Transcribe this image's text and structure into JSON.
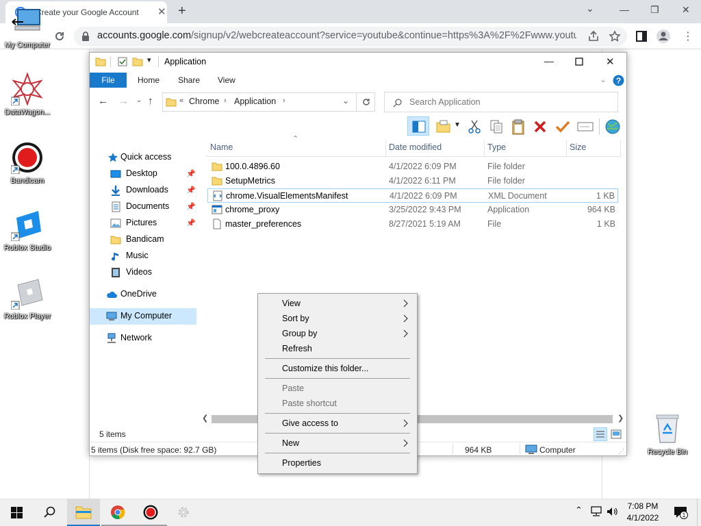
{
  "browser": {
    "tab_title": "Create your Google Account",
    "url_host": "accounts.google.com",
    "url_path": "/signup/v2/webcreateaccount?service=youtube&continue=https%3A%2F%2Fwww.youtub..."
  },
  "desktop_icons": [
    {
      "label": "My Computer",
      "icon": "computer-icon"
    },
    {
      "label": "DataWagon...",
      "icon": "datawagon-icon"
    },
    {
      "label": "Bandicam",
      "icon": "bandicam-icon"
    },
    {
      "label": "Roblox Studio",
      "icon": "roblox-studio-icon"
    },
    {
      "label": "Roblox Player",
      "icon": "roblox-player-icon"
    },
    {
      "label": "Recycle Bin",
      "icon": "recycle-bin-icon"
    }
  ],
  "explorer": {
    "title": "Application",
    "ribbon_tabs": [
      "File",
      "Home",
      "Share",
      "View"
    ],
    "breadcrumb": [
      "Chrome",
      "Application"
    ],
    "search_placeholder": "Search Application",
    "nav": [
      {
        "label": "Quick access",
        "icon": "star-icon"
      },
      {
        "label": "Desktop",
        "icon": "desktop-folder-icon",
        "pinned": true
      },
      {
        "label": "Downloads",
        "icon": "download-icon",
        "pinned": true
      },
      {
        "label": "Documents",
        "icon": "documents-icon",
        "pinned": true
      },
      {
        "label": "Pictures",
        "icon": "pictures-icon",
        "pinned": true
      },
      {
        "label": "Bandicam",
        "icon": "folder-icon"
      },
      {
        "label": "Music",
        "icon": "music-icon"
      },
      {
        "label": "Videos",
        "icon": "videos-icon"
      },
      {
        "label": "OneDrive",
        "icon": "cloud-icon"
      },
      {
        "label": "My Computer",
        "icon": "computer-icon",
        "selected": true
      },
      {
        "label": "Network",
        "icon": "network-icon"
      }
    ],
    "columns": [
      "Name",
      "Date modified",
      "Type",
      "Size"
    ],
    "files": [
      {
        "name": "100.0.4896.60",
        "date": "4/1/2022 6:09 PM",
        "type": "File folder",
        "size": "",
        "icon": "folder-icon"
      },
      {
        "name": "SetupMetrics",
        "date": "4/1/2022 6:11 PM",
        "type": "File folder",
        "size": "",
        "icon": "folder-icon"
      },
      {
        "name": "chrome.VisualElementsManifest",
        "date": "4/1/2022 6:09 PM",
        "type": "XML Document",
        "size": "1 KB",
        "icon": "xml-file-icon"
      },
      {
        "name": "chrome_proxy",
        "date": "3/25/2022 9:43 PM",
        "type": "Application",
        "size": "964 KB",
        "icon": "application-icon"
      },
      {
        "name": "master_preferences",
        "date": "8/27/2021 5:19 AM",
        "type": "File",
        "size": "1 KB",
        "icon": "file-icon"
      }
    ],
    "status_count": "5 items",
    "status_disk": "5 items (Disk free space: 92.7 GB)",
    "status_size": "964 KB",
    "status_location": "Computer"
  },
  "context_menu": {
    "items": [
      {
        "label": "View",
        "submenu": true,
        "disabled": false
      },
      {
        "label": "Sort by",
        "submenu": true,
        "disabled": false
      },
      {
        "label": "Group by",
        "submenu": true,
        "disabled": false
      },
      {
        "label": "Refresh",
        "submenu": false,
        "disabled": false
      },
      {
        "label": "Customize this folder...",
        "submenu": false,
        "disabled": false
      },
      {
        "label": "Paste",
        "submenu": false,
        "disabled": true
      },
      {
        "label": "Paste shortcut",
        "submenu": false,
        "disabled": true
      },
      {
        "label": "Give access to",
        "submenu": true,
        "disabled": false
      },
      {
        "label": "New",
        "submenu": true,
        "disabled": false
      },
      {
        "label": "Properties",
        "submenu": false,
        "disabled": false
      }
    ]
  },
  "taskbar": {
    "time": "7:08 PM",
    "date": "4/1/2022",
    "notification_count": "1"
  },
  "colors": {
    "accent": "#1979ca",
    "folder": "#f8d775",
    "selection": "#cce8ff"
  }
}
